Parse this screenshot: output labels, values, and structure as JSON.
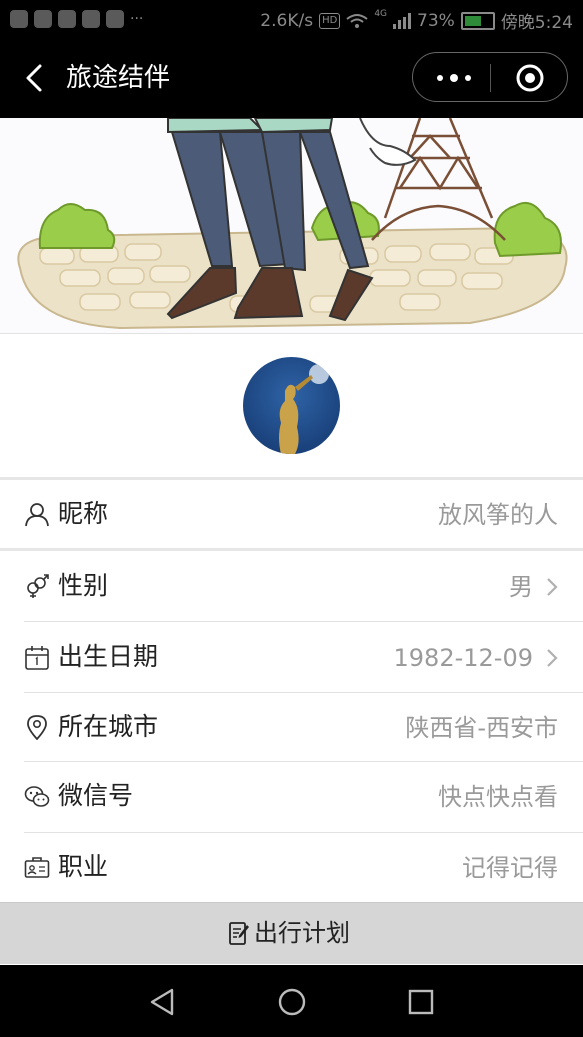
{
  "status_bar": {
    "speed": "2.6K/s",
    "hd": "HD",
    "network": "4G",
    "battery": "73%",
    "battery_level": 0.73,
    "time": "傍晚5:24",
    "overflow": "···"
  },
  "nav": {
    "title": "旅途结伴",
    "back_icon": "chevron-left-icon",
    "more_icon": "more-dots-icon",
    "close_icon": "target-close-icon"
  },
  "profile": {
    "rows": [
      {
        "icon": "person-icon",
        "label": "昵称",
        "value": "放风筝的人",
        "chevron": false
      },
      {
        "icon": "gender-icon",
        "label": "性别",
        "value": "男",
        "chevron": true
      },
      {
        "icon": "calendar-icon",
        "label": "出生日期",
        "value": "1982-12-09",
        "chevron": true
      },
      {
        "icon": "location-pin-icon",
        "label": "所在城市",
        "value": "陕西省-西安市",
        "chevron": false
      },
      {
        "icon": "wechat-icon",
        "label": "微信号",
        "value": "快点快点看",
        "chevron": false
      },
      {
        "icon": "id-card-icon",
        "label": "职业",
        "value": "记得记得",
        "chevron": false
      }
    ]
  },
  "plan_button": {
    "label": "出行计划",
    "icon": "edit-note-icon"
  },
  "colors": {
    "nav_bg": "#000000",
    "value_text": "#9a9a9a",
    "button_bg": "#d6d6d6"
  }
}
